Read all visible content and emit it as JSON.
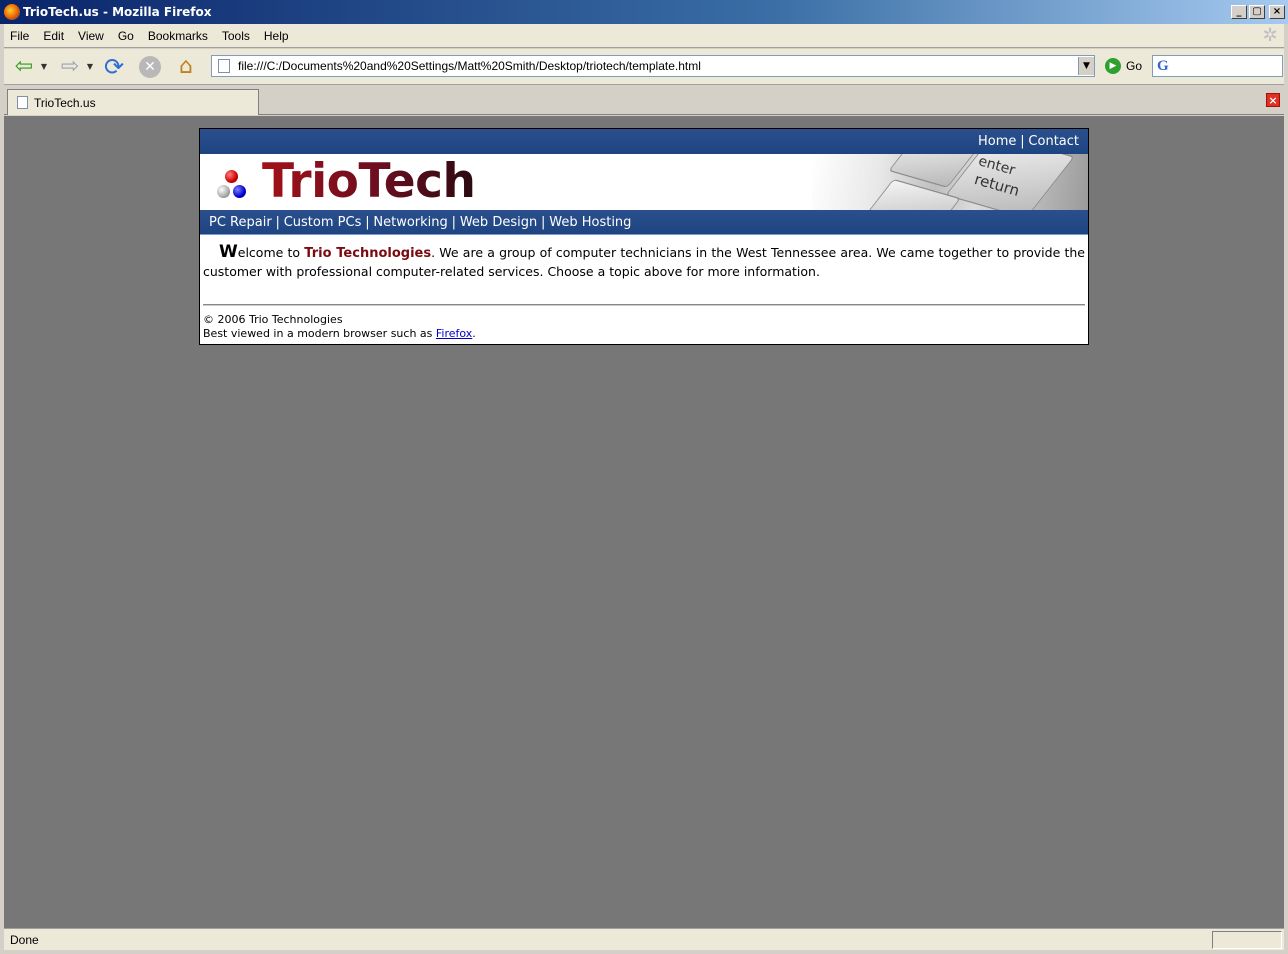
{
  "window": {
    "title": "TrioTech.us - Mozilla Firefox",
    "buttons": {
      "minimize": "_",
      "maximize": "▢",
      "close": "×"
    }
  },
  "menubar": {
    "items": [
      "File",
      "Edit",
      "View",
      "Go",
      "Bookmarks",
      "Tools",
      "Help"
    ]
  },
  "navbar": {
    "url": "file:///C:/Documents%20and%20Settings/Matt%20Smith/Desktop/triotech/template.html",
    "go_label": "Go",
    "search_value": ""
  },
  "tabs": [
    {
      "label": "TrioTech.us"
    }
  ],
  "status": {
    "text": "Done"
  },
  "site": {
    "top_nav": {
      "home": "Home",
      "separator": "|",
      "contact": "Contact"
    },
    "logo_text": "TrioTech",
    "keyboard_keys": {
      "enter": "enter",
      "return": "return"
    },
    "sub_nav": {
      "separator": "|",
      "items": [
        "PC Repair",
        "Custom PCs",
        "Networking",
        "Web Design",
        "Web Hosting"
      ]
    },
    "welcome": {
      "dropcap": "W",
      "lead": "elcome to ",
      "brand": "Trio Technologies",
      "body": ". We are a group of computer technicians in the West Tennessee area. We came together to provide the customer with professional computer-related services. Choose a topic above for more information."
    },
    "footer": {
      "copyright": "© 2006 Trio Technologies",
      "best_viewed_prefix": "Best viewed in a modern browser such as ",
      "link_text": "Firefox",
      "suffix": "."
    }
  },
  "colors": {
    "nav_blue": "#1e4482",
    "brand_red": "#7a0a10",
    "viewport_gray": "#777777",
    "link_blue": "#0000cc"
  }
}
